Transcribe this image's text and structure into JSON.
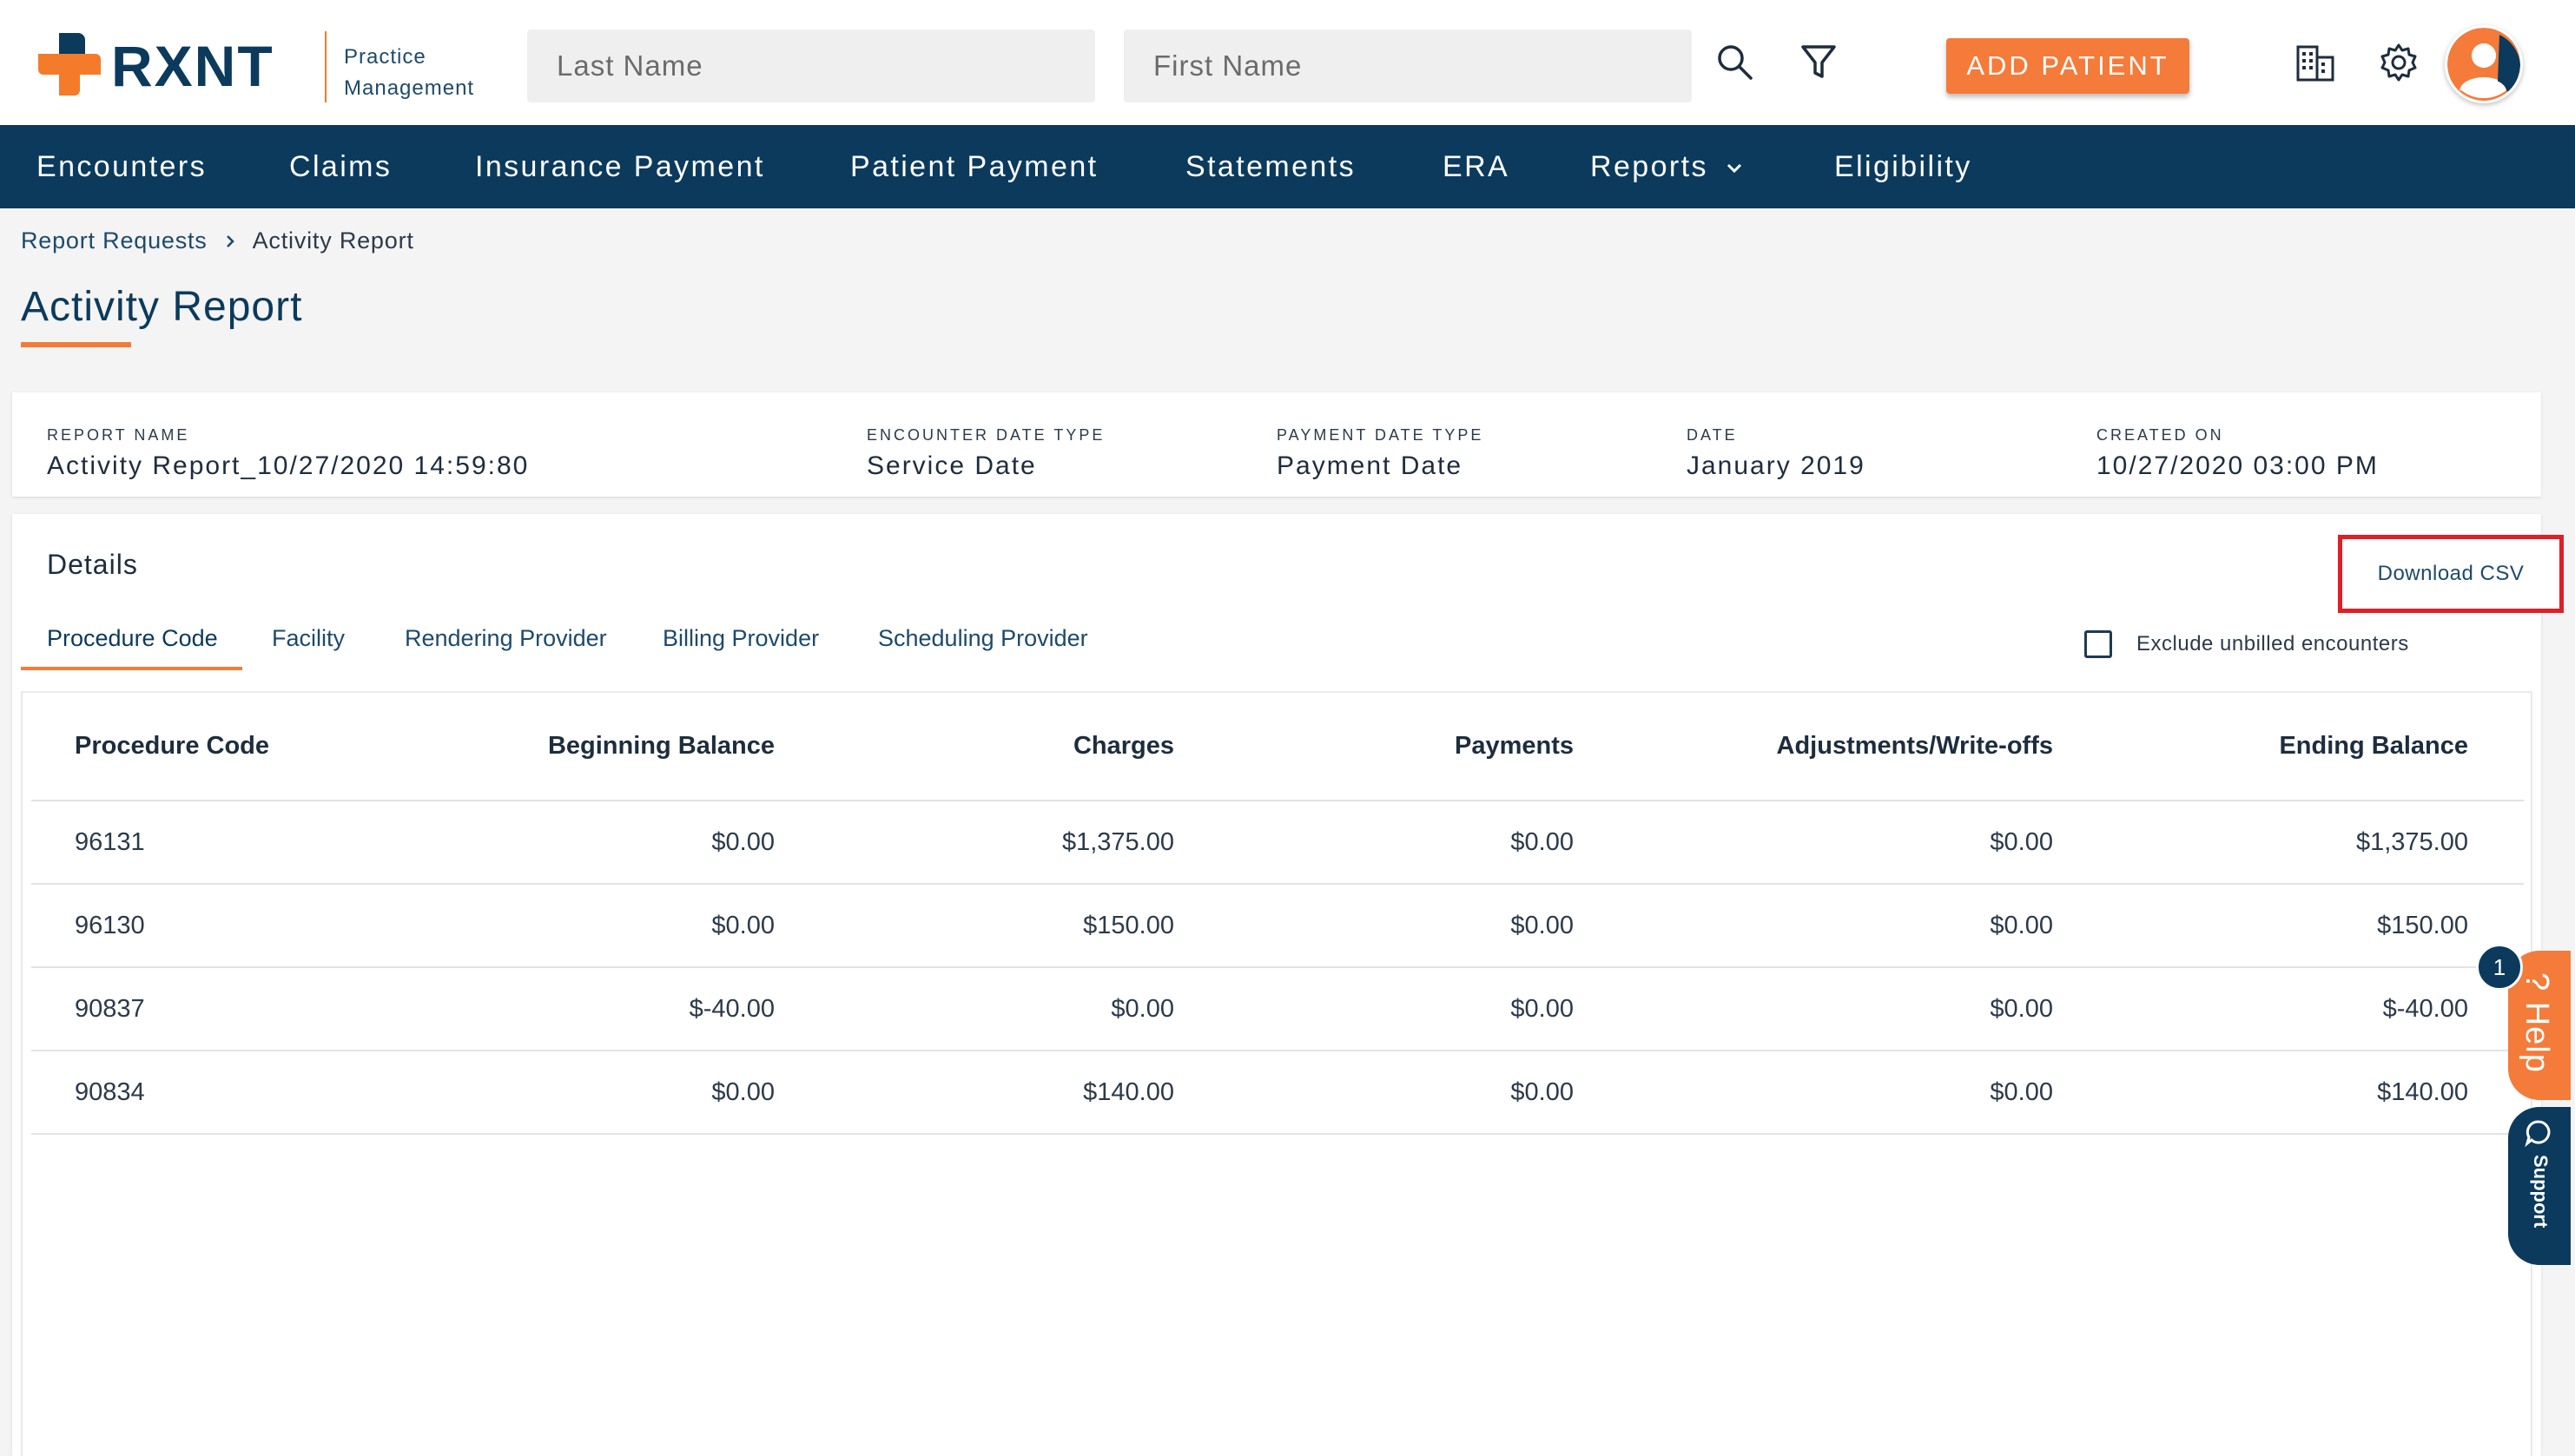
{
  "header": {
    "brand": "RXNT",
    "brand_sub_line1": "Practice",
    "brand_sub_line2": "Management",
    "last_name_placeholder": "Last Name",
    "first_name_placeholder": "First Name",
    "add_patient_label": "ADD PATIENT",
    "icons": [
      "search-icon",
      "filter-icon",
      "building-icon",
      "gear-icon",
      "user-avatar-icon"
    ]
  },
  "nav": {
    "items": [
      {
        "label": "Encounters"
      },
      {
        "label": "Claims"
      },
      {
        "label": "Insurance Payment"
      },
      {
        "label": "Patient Payment"
      },
      {
        "label": "Statements"
      },
      {
        "label": "ERA"
      },
      {
        "label": "Reports"
      },
      {
        "label": "Eligibility"
      }
    ]
  },
  "breadcrumb": {
    "parent": "Report Requests",
    "current": "Activity Report"
  },
  "page": {
    "title": "Activity Report"
  },
  "summary": {
    "report_name_label": "REPORT NAME",
    "report_name": "Activity Report_10/27/2020 14:59:80",
    "encounter_date_type_label": "ENCOUNTER DATE TYPE",
    "encounter_date_type": "Service Date",
    "payment_date_type_label": "PAYMENT DATE TYPE",
    "payment_date_type": "Payment Date",
    "date_label": "DATE",
    "date": "January 2019",
    "created_on_label": "CREATED ON",
    "created_on": "10/27/2020 03:00 PM"
  },
  "details": {
    "title": "Details",
    "download_label": "Download CSV",
    "exclude_label": "Exclude unbilled encounters",
    "exclude_checked": false,
    "tabs": [
      {
        "label": "Procedure Code",
        "active": true
      },
      {
        "label": "Facility",
        "active": false
      },
      {
        "label": "Rendering Provider",
        "active": false
      },
      {
        "label": "Billing Provider",
        "active": false
      },
      {
        "label": "Scheduling Provider",
        "active": false
      }
    ],
    "table": {
      "columns": [
        "Procedure Code",
        "Beginning Balance",
        "Charges",
        "Payments",
        "Adjustments/Write-offs",
        "Ending Balance"
      ],
      "rows": [
        [
          "96131",
          "$0.00",
          "$1,375.00",
          "$0.00",
          "$0.00",
          "$1,375.00"
        ],
        [
          "96130",
          "$0.00",
          "$150.00",
          "$0.00",
          "$0.00",
          "$150.00"
        ],
        [
          "90837",
          "$-40.00",
          "$0.00",
          "$0.00",
          "$0.00",
          "$-40.00"
        ],
        [
          "90834",
          "$0.00",
          "$140.00",
          "$0.00",
          "$0.00",
          "$140.00"
        ]
      ]
    }
  },
  "widgets": {
    "help_label": "Help",
    "help_badge": "1",
    "support_label": "Support"
  },
  "colors": {
    "navy": "#0b3a5c",
    "orange": "#f47b3a",
    "highlight_red": "#e01f26"
  }
}
